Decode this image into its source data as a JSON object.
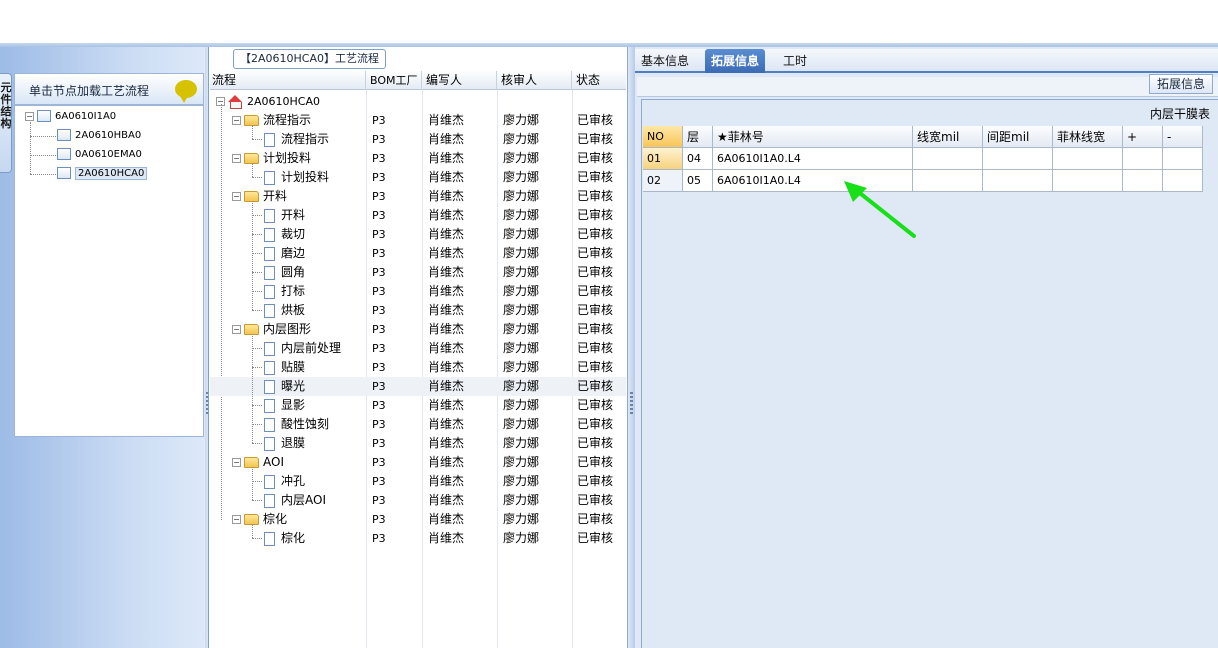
{
  "left_panel": {
    "side_tab_label": "元件结构",
    "load_header": "单击节点加载工艺流程",
    "tree": [
      {
        "label": "6A0610I1A0",
        "level": 0
      },
      {
        "label": "2A0610HBA0",
        "level": 1
      },
      {
        "label": "0A0610EMA0",
        "level": 1
      },
      {
        "label": "2A0610HCA0",
        "level": 1,
        "selected": true
      }
    ]
  },
  "middle_panel": {
    "title": "【2A0610HCA0】工艺流程",
    "columns": {
      "flow": "流程",
      "bom": "BOM工厂",
      "writer": "编写人",
      "reviewer": "核审人",
      "status": "状态"
    },
    "root": "2A0610HCA0",
    "rows": [
      {
        "label": "流程指示",
        "type": "folder",
        "bom": "P3",
        "writer": "肖维杰",
        "reviewer": "廖力娜",
        "status": "已审核"
      },
      {
        "label": "流程指示",
        "type": "page",
        "bom": "P3",
        "writer": "肖维杰",
        "reviewer": "廖力娜",
        "status": "已审核"
      },
      {
        "label": "计划投料",
        "type": "folder",
        "bom": "P3",
        "writer": "肖维杰",
        "reviewer": "廖力娜",
        "status": "已审核"
      },
      {
        "label": "计划投料",
        "type": "page",
        "bom": "P3",
        "writer": "肖维杰",
        "reviewer": "廖力娜",
        "status": "已审核"
      },
      {
        "label": "开料",
        "type": "folder",
        "bom": "P3",
        "writer": "肖维杰",
        "reviewer": "廖力娜",
        "status": "已审核"
      },
      {
        "label": "开料",
        "type": "page",
        "bom": "P3",
        "writer": "肖维杰",
        "reviewer": "廖力娜",
        "status": "已审核"
      },
      {
        "label": "裁切",
        "type": "page",
        "bom": "P3",
        "writer": "肖维杰",
        "reviewer": "廖力娜",
        "status": "已审核"
      },
      {
        "label": "磨边",
        "type": "page",
        "bom": "P3",
        "writer": "肖维杰",
        "reviewer": "廖力娜",
        "status": "已审核"
      },
      {
        "label": "圆角",
        "type": "page",
        "bom": "P3",
        "writer": "肖维杰",
        "reviewer": "廖力娜",
        "status": "已审核"
      },
      {
        "label": "打标",
        "type": "page",
        "bom": "P3",
        "writer": "肖维杰",
        "reviewer": "廖力娜",
        "status": "已审核"
      },
      {
        "label": "烘板",
        "type": "page",
        "bom": "P3",
        "writer": "肖维杰",
        "reviewer": "廖力娜",
        "status": "已审核"
      },
      {
        "label": "内层图形",
        "type": "folder",
        "bom": "P3",
        "writer": "肖维杰",
        "reviewer": "廖力娜",
        "status": "已审核"
      },
      {
        "label": "内层前处理",
        "type": "page",
        "bom": "P3",
        "writer": "肖维杰",
        "reviewer": "廖力娜",
        "status": "已审核"
      },
      {
        "label": "贴膜",
        "type": "page",
        "bom": "P3",
        "writer": "肖维杰",
        "reviewer": "廖力娜",
        "status": "已审核"
      },
      {
        "label": "曝光",
        "type": "page",
        "bom": "P3",
        "writer": "肖维杰",
        "reviewer": "廖力娜",
        "status": "已审核",
        "highlight": true
      },
      {
        "label": "显影",
        "type": "page",
        "bom": "P3",
        "writer": "肖维杰",
        "reviewer": "廖力娜",
        "status": "已审核"
      },
      {
        "label": "酸性蚀刻",
        "type": "page",
        "bom": "P3",
        "writer": "肖维杰",
        "reviewer": "廖力娜",
        "status": "已审核"
      },
      {
        "label": "退膜",
        "type": "page",
        "bom": "P3",
        "writer": "肖维杰",
        "reviewer": "廖力娜",
        "status": "已审核"
      },
      {
        "label": "AOI",
        "type": "folder",
        "bom": "P3",
        "writer": "肖维杰",
        "reviewer": "廖力娜",
        "status": "已审核"
      },
      {
        "label": "冲孔",
        "type": "page",
        "bom": "P3",
        "writer": "肖维杰",
        "reviewer": "廖力娜",
        "status": "已审核"
      },
      {
        "label": "内层AOI",
        "type": "page",
        "bom": "P3",
        "writer": "肖维杰",
        "reviewer": "廖力娜",
        "status": "已审核"
      },
      {
        "label": "棕化",
        "type": "folder",
        "bom": "P3",
        "writer": "肖维杰",
        "reviewer": "廖力娜",
        "status": "已审核"
      },
      {
        "label": "棕化",
        "type": "page",
        "bom": "P3",
        "writer": "肖维杰",
        "reviewer": "廖力娜",
        "status": "已审核"
      }
    ]
  },
  "right_panel": {
    "tabs": [
      {
        "label": "基本信息",
        "active": false
      },
      {
        "label": "拓展信息",
        "active": true
      },
      {
        "label": "工时",
        "active": false
      }
    ],
    "ext_button": "拓展信息",
    "caption": "内层干膜表",
    "columns": [
      "NO",
      "层",
      "★菲林号",
      "线宽mil",
      "间距mil",
      "菲林线宽",
      "+",
      "-"
    ],
    "rows": [
      [
        "01",
        "04",
        "6A0610I1A0.L4",
        "",
        "",
        "",
        "",
        ""
      ],
      [
        "02",
        "05",
        "6A0610I1A0.L4",
        "",
        "",
        "",
        "",
        ""
      ]
    ]
  },
  "colors": {
    "accent": "#3b6bb3",
    "arrow": "#18e018",
    "nav_gradient": "#9cbbe6"
  }
}
